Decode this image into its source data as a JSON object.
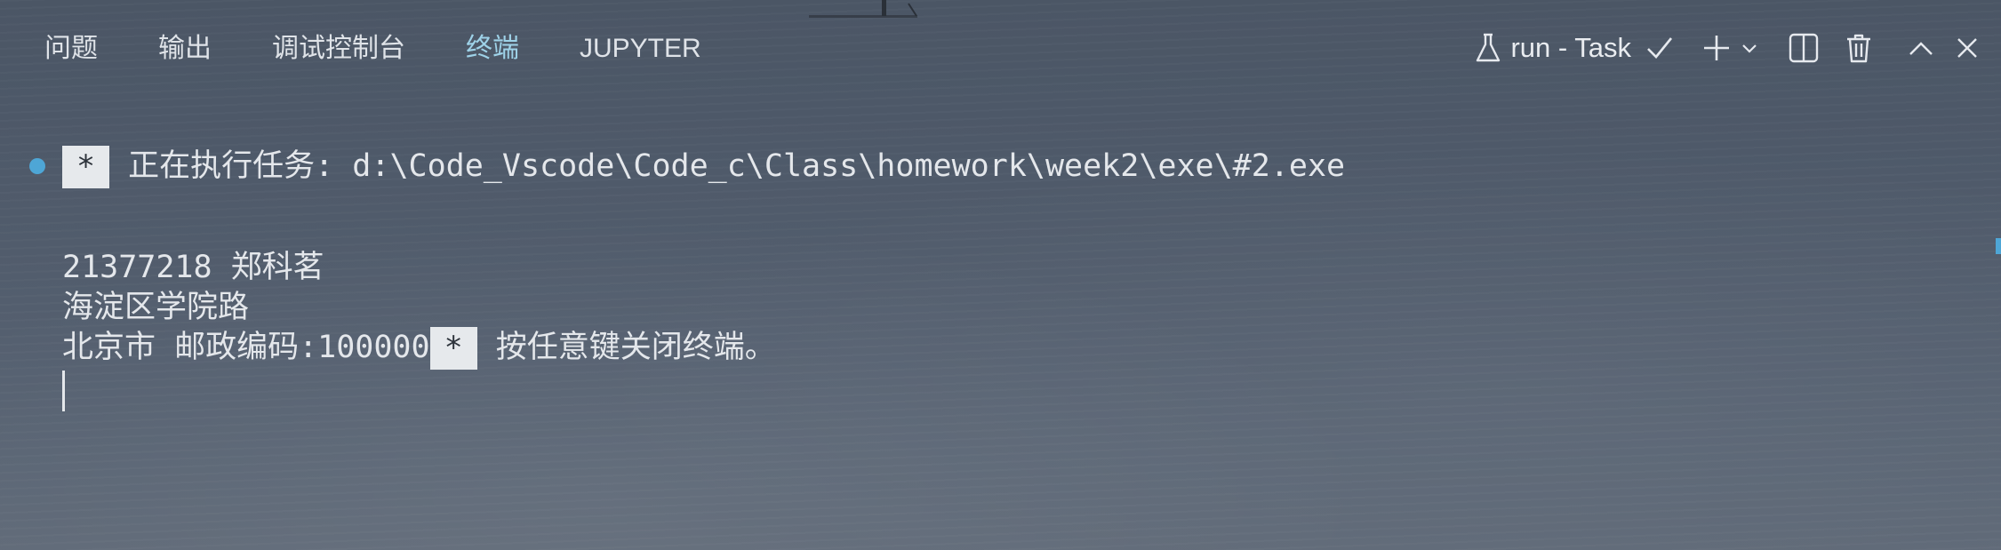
{
  "panel": {
    "tabs": [
      {
        "label": "问题"
      },
      {
        "label": "输出"
      },
      {
        "label": "调试控制台"
      },
      {
        "label": "终端"
      },
      {
        "label": "JUPYTER"
      }
    ],
    "active_tab": "终端",
    "task_name": "run - Task",
    "icons": {
      "task": "flask-icon",
      "check": "check-icon",
      "new_terminal": "plus-icon",
      "dropdown": "chevron-down-icon",
      "split": "split-icon",
      "trash": "trash-icon",
      "maximize": "chevron-up-icon",
      "close": "close-icon"
    }
  },
  "terminal": {
    "badge": "*",
    "task_line": "正在执行任务: d:\\Code_Vscode\\Code_c\\Class\\homework\\week2\\exe\\#2.exe",
    "output_lines": [
      "21377218 郑科茗",
      "海淀区学院路",
      "北京市 邮政编码:100000"
    ],
    "close_prompt": "按任意键关闭终端。"
  },
  "colors": {
    "active_tab": "#9ed2e8",
    "status_dot": "#4ea6d6",
    "badge_bg": "#e6e9ec",
    "text": "#e4e7eb"
  }
}
